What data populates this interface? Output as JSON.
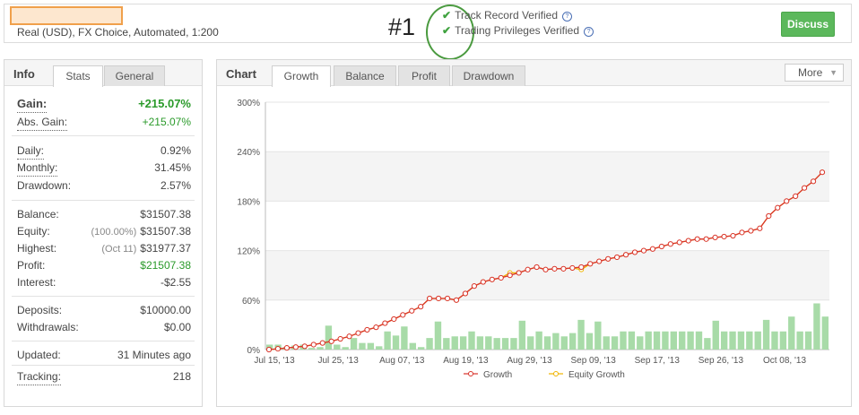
{
  "account": {
    "name": "",
    "description": "Real (USD), FX Choice, Automated, 1:200",
    "rank": "#1",
    "verifications": [
      "Track Record Verified",
      "Trading Privileges Verified"
    ],
    "discuss_label": "Discuss"
  },
  "info_panel": {
    "title": "Info",
    "tabs": [
      {
        "label": "Stats",
        "active": true
      },
      {
        "label": "General",
        "active": false
      }
    ],
    "gain": {
      "label": "Gain:",
      "value": "+215.07%"
    },
    "abs_gain": {
      "label": "Abs. Gain:",
      "value": "+215.07%"
    },
    "daily": {
      "label": "Daily:",
      "value": "0.92%"
    },
    "monthly": {
      "label": "Monthly:",
      "value": "31.45%"
    },
    "drawdown": {
      "label": "Drawdown:",
      "value": "2.57%"
    },
    "balance": {
      "label": "Balance:",
      "value": "$31507.38"
    },
    "equity": {
      "label": "Equity:",
      "note": "(100.00%)",
      "value": "$31507.38"
    },
    "highest": {
      "label": "Highest:",
      "note": "(Oct 11)",
      "value": "$31977.37"
    },
    "profit": {
      "label": "Profit:",
      "value": "$21507.38"
    },
    "interest": {
      "label": "Interest:",
      "value": "-$2.55"
    },
    "deposits": {
      "label": "Deposits:",
      "value": "$10000.00"
    },
    "withdrawals": {
      "label": "Withdrawals:",
      "value": "$0.00"
    },
    "updated": {
      "label": "Updated:",
      "value": "31 Minutes ago"
    },
    "tracking": {
      "label": "Tracking:",
      "value": "218"
    }
  },
  "chart_panel": {
    "title": "Chart",
    "tabs": [
      {
        "label": "Growth",
        "active": true
      },
      {
        "label": "Balance",
        "active": false
      },
      {
        "label": "Profit",
        "active": false
      },
      {
        "label": "Drawdown",
        "active": false
      }
    ],
    "more_label": "More",
    "colors": {
      "growth": "#d9342b",
      "equity": "#f0b400",
      "bars": "#a8dba8"
    }
  },
  "chart_data": {
    "type": "line",
    "title": "",
    "xlabel": "",
    "ylabel": "",
    "ylim": [
      0,
      300
    ],
    "yticks": [
      "0%",
      "60%",
      "120%",
      "180%",
      "240%",
      "300%"
    ],
    "xticks": [
      "Jul 15, '13",
      "Jul 25, '13",
      "Aug 07, '13",
      "Aug 19, '13",
      "Aug 29, '13",
      "Sep 09, '13",
      "Sep 17, '13",
      "Sep 26, '13",
      "Oct 08, '13"
    ],
    "grid": true,
    "legend": "bottom",
    "series": [
      {
        "name": "Growth",
        "values": [
          0,
          1,
          2,
          3,
          4,
          6,
          8,
          10,
          13,
          16,
          20,
          24,
          27,
          32,
          37,
          42,
          47,
          52,
          62,
          62,
          62,
          60,
          68,
          77,
          82,
          85,
          87,
          90,
          93,
          97,
          100,
          97,
          98,
          98,
          99,
          100,
          104,
          107,
          110,
          112,
          115,
          118,
          120,
          122,
          125,
          128,
          130,
          132,
          134,
          134,
          136,
          137,
          138,
          142,
          144,
          147,
          162,
          172,
          180,
          186,
          196,
          204,
          215
        ]
      },
      {
        "name": "Equity Growth",
        "values": [
          0,
          1,
          2,
          3,
          4,
          6,
          8,
          10,
          13,
          16,
          20,
          24,
          27,
          32,
          37,
          42,
          47,
          52,
          62,
          62,
          62,
          60,
          68,
          77,
          82,
          85,
          87,
          93,
          93,
          97,
          100,
          97,
          98,
          98,
          99,
          97,
          104,
          107,
          110,
          112,
          115,
          118,
          120,
          122,
          125,
          128,
          130,
          132,
          134,
          134,
          136,
          137,
          138,
          142,
          144,
          147,
          162,
          172,
          180,
          186,
          196,
          204,
          215
        ]
      }
    ],
    "daily_bars": [
      6,
      6,
      3,
      5,
      6,
      2,
      3,
      29,
      6,
      3,
      14,
      8,
      8,
      4,
      22,
      17,
      28,
      8,
      3,
      14,
      34,
      14,
      16,
      16,
      22,
      16,
      16,
      14,
      14,
      14,
      35,
      16,
      22,
      16,
      20,
      16,
      20,
      36,
      20,
      34,
      16,
      16,
      22,
      22,
      16,
      22,
      22,
      22,
      22,
      22,
      22,
      22,
      14,
      35,
      22,
      22,
      22,
      22,
      22,
      36,
      22,
      22,
      40,
      22,
      22,
      56,
      40
    ]
  }
}
